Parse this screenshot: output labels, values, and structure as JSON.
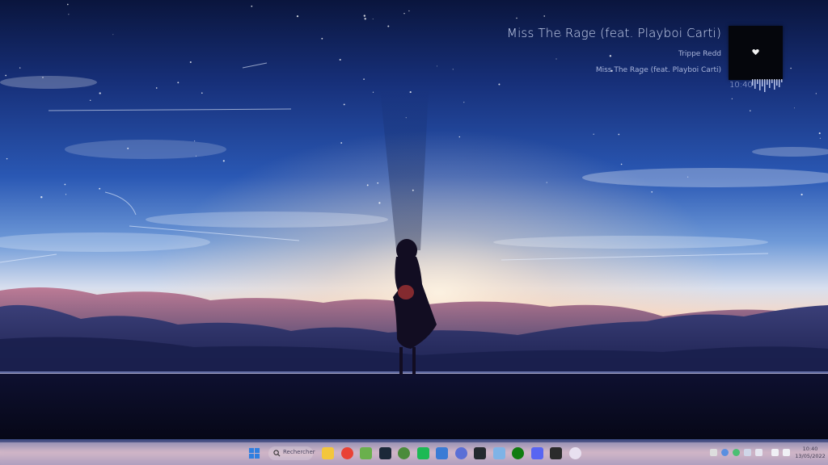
{
  "now_playing": {
    "title": "Miss The Rage (feat. Playboi Carti)",
    "artist": "Trippe Redd",
    "album": "Miss The Rage (feat. Playboi Carti)",
    "time": "10:40",
    "cover_icon": "heart-icon"
  },
  "taskbar": {
    "search_label": "Rechercher",
    "apps": [
      {
        "name": "file-explorer-icon",
        "color": "#f3c63c"
      },
      {
        "name": "chrome-icon",
        "color": "#e94235"
      },
      {
        "name": "bluestacks-icon",
        "color": "#6ab04c"
      },
      {
        "name": "steam-icon",
        "color": "#1b2838"
      },
      {
        "name": "minecraft-icon",
        "color": "#4b8b3b"
      },
      {
        "name": "spotify-icon",
        "color": "#1db954"
      },
      {
        "name": "mail-icon",
        "color": "#3a7bd5"
      },
      {
        "name": "app-icon",
        "color": "#5b6fd6"
      },
      {
        "name": "github-icon",
        "color": "#24292e"
      },
      {
        "name": "photos-icon",
        "color": "#7fb3e6"
      },
      {
        "name": "xbox-icon",
        "color": "#107c10"
      },
      {
        "name": "discord-icon",
        "color": "#5865f2"
      },
      {
        "name": "terminal-icon",
        "color": "#2b2b2b"
      },
      {
        "name": "notepad-icon",
        "color": "#e8e0f0"
      }
    ],
    "clock_time": "10:40",
    "clock_date": "13/05/2022"
  },
  "colors": {
    "sky_top": "#0c1a4a",
    "sky_mid": "#2e5db7",
    "horizon": "#f3d6c8",
    "ground": "#0a0b20"
  }
}
